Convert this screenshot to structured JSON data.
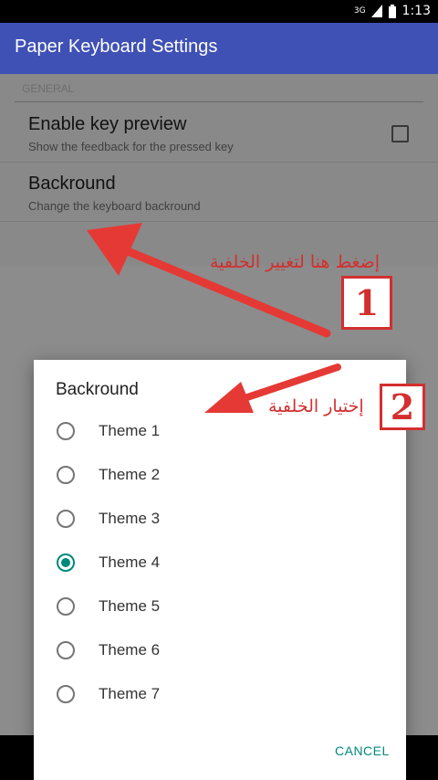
{
  "status_bar": {
    "network": "3G",
    "time": "1:13"
  },
  "app_bar": {
    "title": "Paper Keyboard Settings"
  },
  "preferences": {
    "section_header": "GENERAL",
    "items": [
      {
        "title": "Enable key preview",
        "summary": "Show the feedback for the pressed key",
        "checked": false
      },
      {
        "title": "Backround",
        "summary": "Change the keyboard backround"
      }
    ]
  },
  "dialog": {
    "title": "Backround",
    "options": [
      {
        "label": "Theme 1",
        "selected": false
      },
      {
        "label": "Theme 2",
        "selected": false
      },
      {
        "label": "Theme 3",
        "selected": false
      },
      {
        "label": "Theme 4",
        "selected": true
      },
      {
        "label": "Theme 5",
        "selected": false
      },
      {
        "label": "Theme 6",
        "selected": false
      },
      {
        "label": "Theme 7",
        "selected": false
      }
    ],
    "cancel_label": "CANCEL"
  },
  "annotations": {
    "label_1": "إضغط هنا لتغيير الخلفية",
    "number_1": "1",
    "label_2": "إختيار الخلفية",
    "number_2": "2",
    "color": "#d32f2f"
  },
  "colors": {
    "app_bar": "#3f51b5",
    "accent": "#00897b"
  }
}
